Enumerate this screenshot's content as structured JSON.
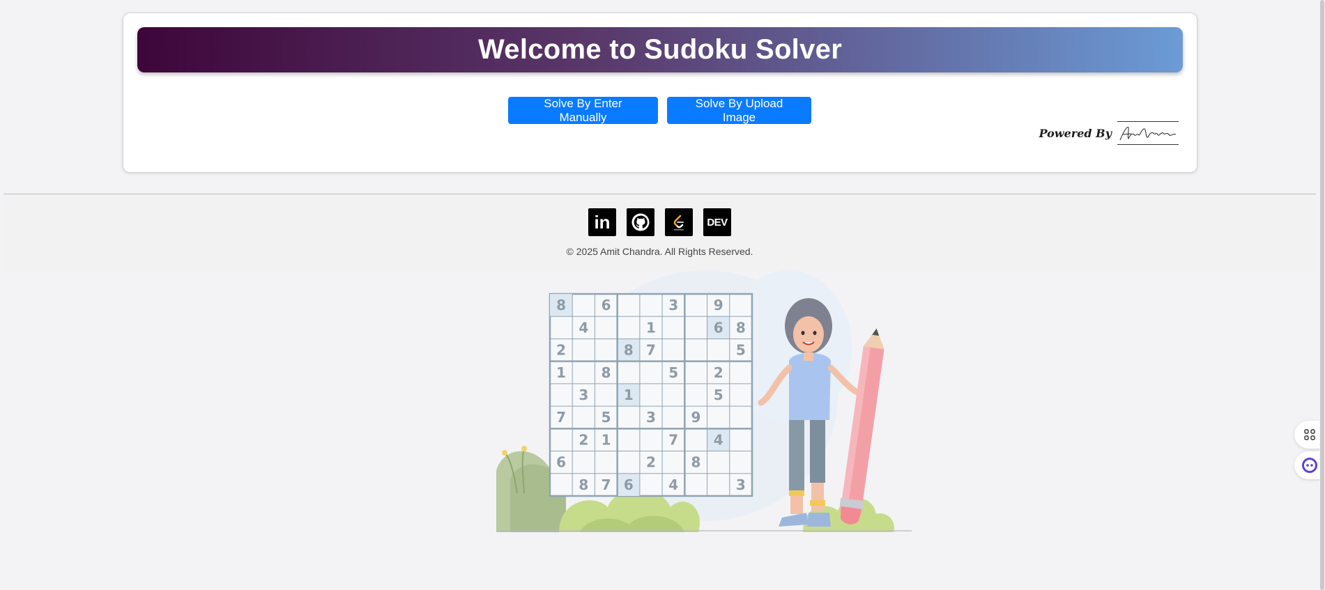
{
  "header": {
    "title": "Welcome to Sudoku Solver"
  },
  "actions": {
    "manual_label": "Solve By Enter Manually",
    "upload_label": "Solve By Upload Image"
  },
  "powered_by": {
    "label": "Powered By",
    "signature": "Amit Chandra"
  },
  "footer": {
    "social": [
      {
        "name": "linkedin-icon",
        "glyph": "in"
      },
      {
        "name": "github-icon",
        "glyph": ""
      },
      {
        "name": "leetcode-icon",
        "glyph": ""
      },
      {
        "name": "dev-icon",
        "glyph": "DEV"
      }
    ],
    "copyright": "© 2025 Amit Chandra. All Rights Reserved."
  },
  "illustration": {
    "sudoku_grid": [
      [
        "8",
        "",
        "6",
        "",
        "",
        "3",
        "",
        "9",
        ""
      ],
      [
        "",
        "4",
        "",
        "",
        "1",
        "",
        "",
        "6",
        "8"
      ],
      [
        "2",
        "",
        "",
        "8",
        "7",
        "",
        "",
        "",
        "5"
      ],
      [
        "1",
        "",
        "8",
        "",
        "",
        "5",
        "",
        "2",
        ""
      ],
      [
        "",
        "3",
        "",
        "1",
        "",
        "",
        "",
        "5",
        ""
      ],
      [
        "7",
        "",
        "5",
        "",
        "3",
        "",
        "9",
        "",
        ""
      ],
      [
        "",
        "2",
        "1",
        "",
        "",
        "7",
        "",
        "4",
        ""
      ],
      [
        "6",
        "",
        "",
        "",
        "2",
        "",
        "8",
        "",
        ""
      ],
      [
        "",
        "8",
        "7",
        "6",
        "",
        "4",
        "",
        "",
        "3"
      ]
    ],
    "highlighted_cells": [
      [
        0,
        0
      ],
      [
        1,
        7
      ],
      [
        2,
        3
      ],
      [
        4,
        3
      ],
      [
        6,
        7
      ],
      [
        8,
        3
      ]
    ]
  },
  "colors": {
    "button": "#0a7bff",
    "banner_start": "#3e063a",
    "banner_end": "#6b9bd6"
  }
}
